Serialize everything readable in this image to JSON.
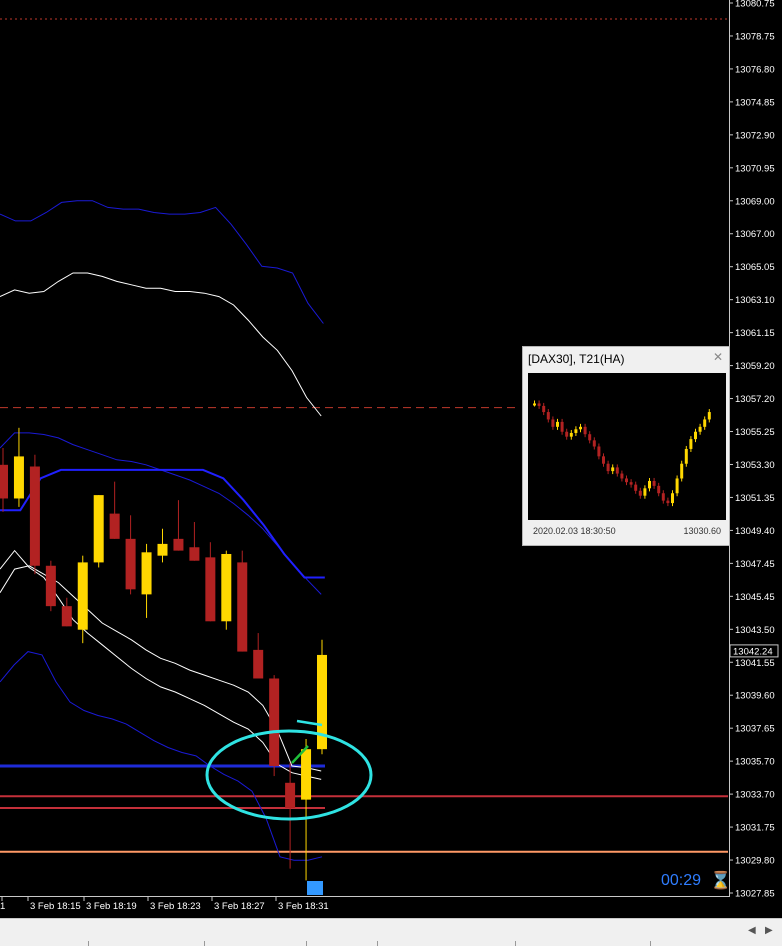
{
  "chart_data": {
    "type": "candlestick",
    "ylim": [
      13027.85,
      13080.75
    ],
    "y_ticks": [
      "13080.75",
      "13078.75",
      "13076.80",
      "13074.85",
      "13072.90",
      "13070.95",
      "13069.00",
      "13067.00",
      "13065.05",
      "13063.10",
      "13061.15",
      "13059.20",
      "13057.20",
      "13055.25",
      "13053.30",
      "13051.35",
      "13049.40",
      "13047.45",
      "13045.45",
      "13043.50",
      "13041.55",
      "13039.60",
      "13037.65",
      "13035.70",
      "13033.70",
      "13031.75",
      "13029.80",
      "13027.85"
    ],
    "x_labels": [
      "1",
      "3 Feb 18:15",
      "3 Feb 18:19",
      "3 Feb 18:23",
      "3 Feb 18:27",
      "3 Feb 18:31"
    ],
    "current_price": "13042.24",
    "candles": [
      {
        "o": 13053.3,
        "h": 13054.3,
        "l": 13050.5,
        "c": 13051.3
      },
      {
        "o": 13051.3,
        "h": 13055.5,
        "l": 13050.8,
        "c": 13053.8
      },
      {
        "o": 13053.2,
        "h": 13053.9,
        "l": 13046.8,
        "c": 13047.3
      },
      {
        "o": 13047.3,
        "h": 13047.6,
        "l": 13044.6,
        "c": 13044.9
      },
      {
        "o": 13044.9,
        "h": 13045.4,
        "l": 13043.7,
        "c": 13043.7
      },
      {
        "o": 13043.5,
        "h": 13047.9,
        "l": 13042.7,
        "c": 13047.5
      },
      {
        "o": 13047.5,
        "h": 13051.5,
        "l": 13047.2,
        "c": 13051.5
      },
      {
        "o": 13050.4,
        "h": 13052.3,
        "l": 13048.9,
        "c": 13048.9
      },
      {
        "o": 13048.9,
        "h": 13050.3,
        "l": 13045.6,
        "c": 13045.9
      },
      {
        "o": 13045.6,
        "h": 13048.6,
        "l": 13044.2,
        "c": 13048.1
      },
      {
        "o": 13047.9,
        "h": 13049.5,
        "l": 13047.5,
        "c": 13048.6
      },
      {
        "o": 13048.9,
        "h": 13051.2,
        "l": 13048.2,
        "c": 13048.2
      },
      {
        "o": 13048.4,
        "h": 13049.9,
        "l": 13047.6,
        "c": 13047.6
      },
      {
        "o": 13047.8,
        "h": 13048.7,
        "l": 13044.0,
        "c": 13044.0
      },
      {
        "o": 13044.0,
        "h": 13048.2,
        "l": 13043.5,
        "c": 13048.0
      },
      {
        "o": 13047.5,
        "h": 13048.2,
        "l": 13042.2,
        "c": 13042.2
      },
      {
        "o": 13042.3,
        "h": 13043.3,
        "l": 13040.6,
        "c": 13040.6
      },
      {
        "o": 13040.6,
        "h": 13040.8,
        "l": 13034.8,
        "c": 13035.4
      },
      {
        "o": 13034.4,
        "h": 13035.6,
        "l": 13029.3,
        "c": 13032.9
      },
      {
        "o": 13033.4,
        "h": 13037.0,
        "l": 13028.6,
        "c": 13036.4
      },
      {
        "o": 13036.4,
        "h": 13042.9,
        "l": 13036.1,
        "c": 13042.0
      }
    ],
    "bands": {
      "outer_upper": [
        13068.2,
        13067.8,
        13067.8,
        13068.3,
        13068.9,
        13069.0,
        13069.0,
        13068.6,
        13068.5,
        13068.5,
        13068.3,
        13068.2,
        13068.2,
        13068.3,
        13068.6,
        13067.6,
        13066.4,
        13065.1,
        13065.0,
        13064.7,
        13062.9,
        13061.7
      ],
      "outer_lower": [
        13040.4,
        13041.4,
        13042.2,
        13042.0,
        13040.4,
        13039.2,
        13038.7,
        13038.4,
        13038.2,
        13037.9,
        13037.4,
        13036.9,
        13036.5,
        13036.2,
        13036.0,
        13035.4,
        13034.9,
        13034.5,
        13033.9,
        13032.3,
        13030.0,
        13029.8,
        13029.8,
        13030.0
      ],
      "middle_upper": [
        13063.3,
        13063.7,
        13063.5,
        13063.6,
        13064.2,
        13064.7,
        13064.7,
        13064.5,
        13064.2,
        13064.0,
        13063.8,
        13063.8,
        13063.6,
        13063.6,
        13063.5,
        13063.3,
        13062.8,
        13061.9,
        13060.9,
        13060.1,
        13058.9,
        13057.3,
        13056.2
      ],
      "middle_lower": [
        13045.7,
        13047.1,
        13047.3,
        13046.8,
        13046.3,
        13045.5,
        13044.7,
        13043.9,
        13043.4,
        13042.9,
        13042.3,
        13041.8,
        13041.5,
        13041.1,
        13040.8,
        13040.5,
        13040.2,
        13039.8,
        13039.0,
        13037.5,
        13035.4,
        13035.3,
        13035.1
      ],
      "inner_upper": [
        13054.3,
        13055.2,
        13055.2,
        13055.1,
        13054.9,
        13054.5,
        13054.2,
        13053.9,
        13053.6,
        13053.5,
        13053.3,
        13053.0,
        13052.7,
        13052.4,
        13052.0,
        13051.6,
        13051.0,
        13050.3,
        13049.5,
        13048.5,
        13047.5,
        13046.5,
        13045.6
      ],
      "inner_lower_white": [
        13047.1,
        13048.2,
        13047.2,
        13046.6,
        13045.4,
        13044.1,
        13043.3,
        13042.6,
        13041.9,
        13041.2,
        13040.6,
        13040.1,
        13039.8,
        13039.4,
        13039.0,
        13038.5,
        13038.0,
        13037.6,
        13036.8,
        13035.5,
        13035.0,
        13034.8,
        13034.6
      ],
      "staircase": [
        13050.6,
        13050.6,
        13052.5,
        13053.0,
        13053.0,
        13053.0,
        13053.0,
        13053.0,
        13053.0,
        13053.0,
        13053.0,
        13052.5,
        13051.2,
        13049.7,
        13048.0,
        13046.6,
        13046.6
      ]
    },
    "levels": [
      {
        "name": "top-dotted",
        "price": 13079.8,
        "color": "#c0392b",
        "style": "dotted"
      },
      {
        "name": "mid-dashed",
        "price": 13056.7,
        "color": "#c0392b",
        "style": "dashed"
      },
      {
        "name": "blue-support",
        "price": 13035.4,
        "color": "#1e2bd8",
        "style": "solid"
      },
      {
        "name": "red-level-1",
        "price": 13033.6,
        "color": "#c4303a",
        "style": "solid"
      },
      {
        "name": "red-level-2",
        "price": 13032.9,
        "color": "#c4303a",
        "style": "solid"
      },
      {
        "name": "orange-level",
        "price": 13030.3,
        "color": "#ff9966",
        "style": "solid"
      }
    ],
    "colors": {
      "bull": "#ffd700",
      "bear": "#b22222",
      "band_blue": "#1a1ad6",
      "band_white": "#ffffff",
      "circle": "#2fe3e3",
      "background": "#000000"
    }
  },
  "mini_window": {
    "title": "[DAX30], T21(HA)",
    "timestamp": "2020.02.03 18:30:50",
    "price": "13030.60",
    "close_icon": "close-icon",
    "candles_norm": [
      0.85,
      0.83,
      0.78,
      0.72,
      0.66,
      0.7,
      0.62,
      0.58,
      0.61,
      0.64,
      0.66,
      0.6,
      0.55,
      0.5,
      0.42,
      0.36,
      0.3,
      0.33,
      0.28,
      0.24,
      0.21,
      0.19,
      0.14,
      0.1,
      0.16,
      0.22,
      0.18,
      0.12,
      0.06,
      0.04,
      0.12,
      0.24,
      0.36,
      0.48,
      0.56,
      0.62,
      0.66,
      0.72,
      0.78
    ]
  },
  "countdown": "00:29",
  "hourglass_icon": "hourglass-icon",
  "scroll_icons": [
    "left-arrow-icon",
    "right-arrow-icon"
  ]
}
